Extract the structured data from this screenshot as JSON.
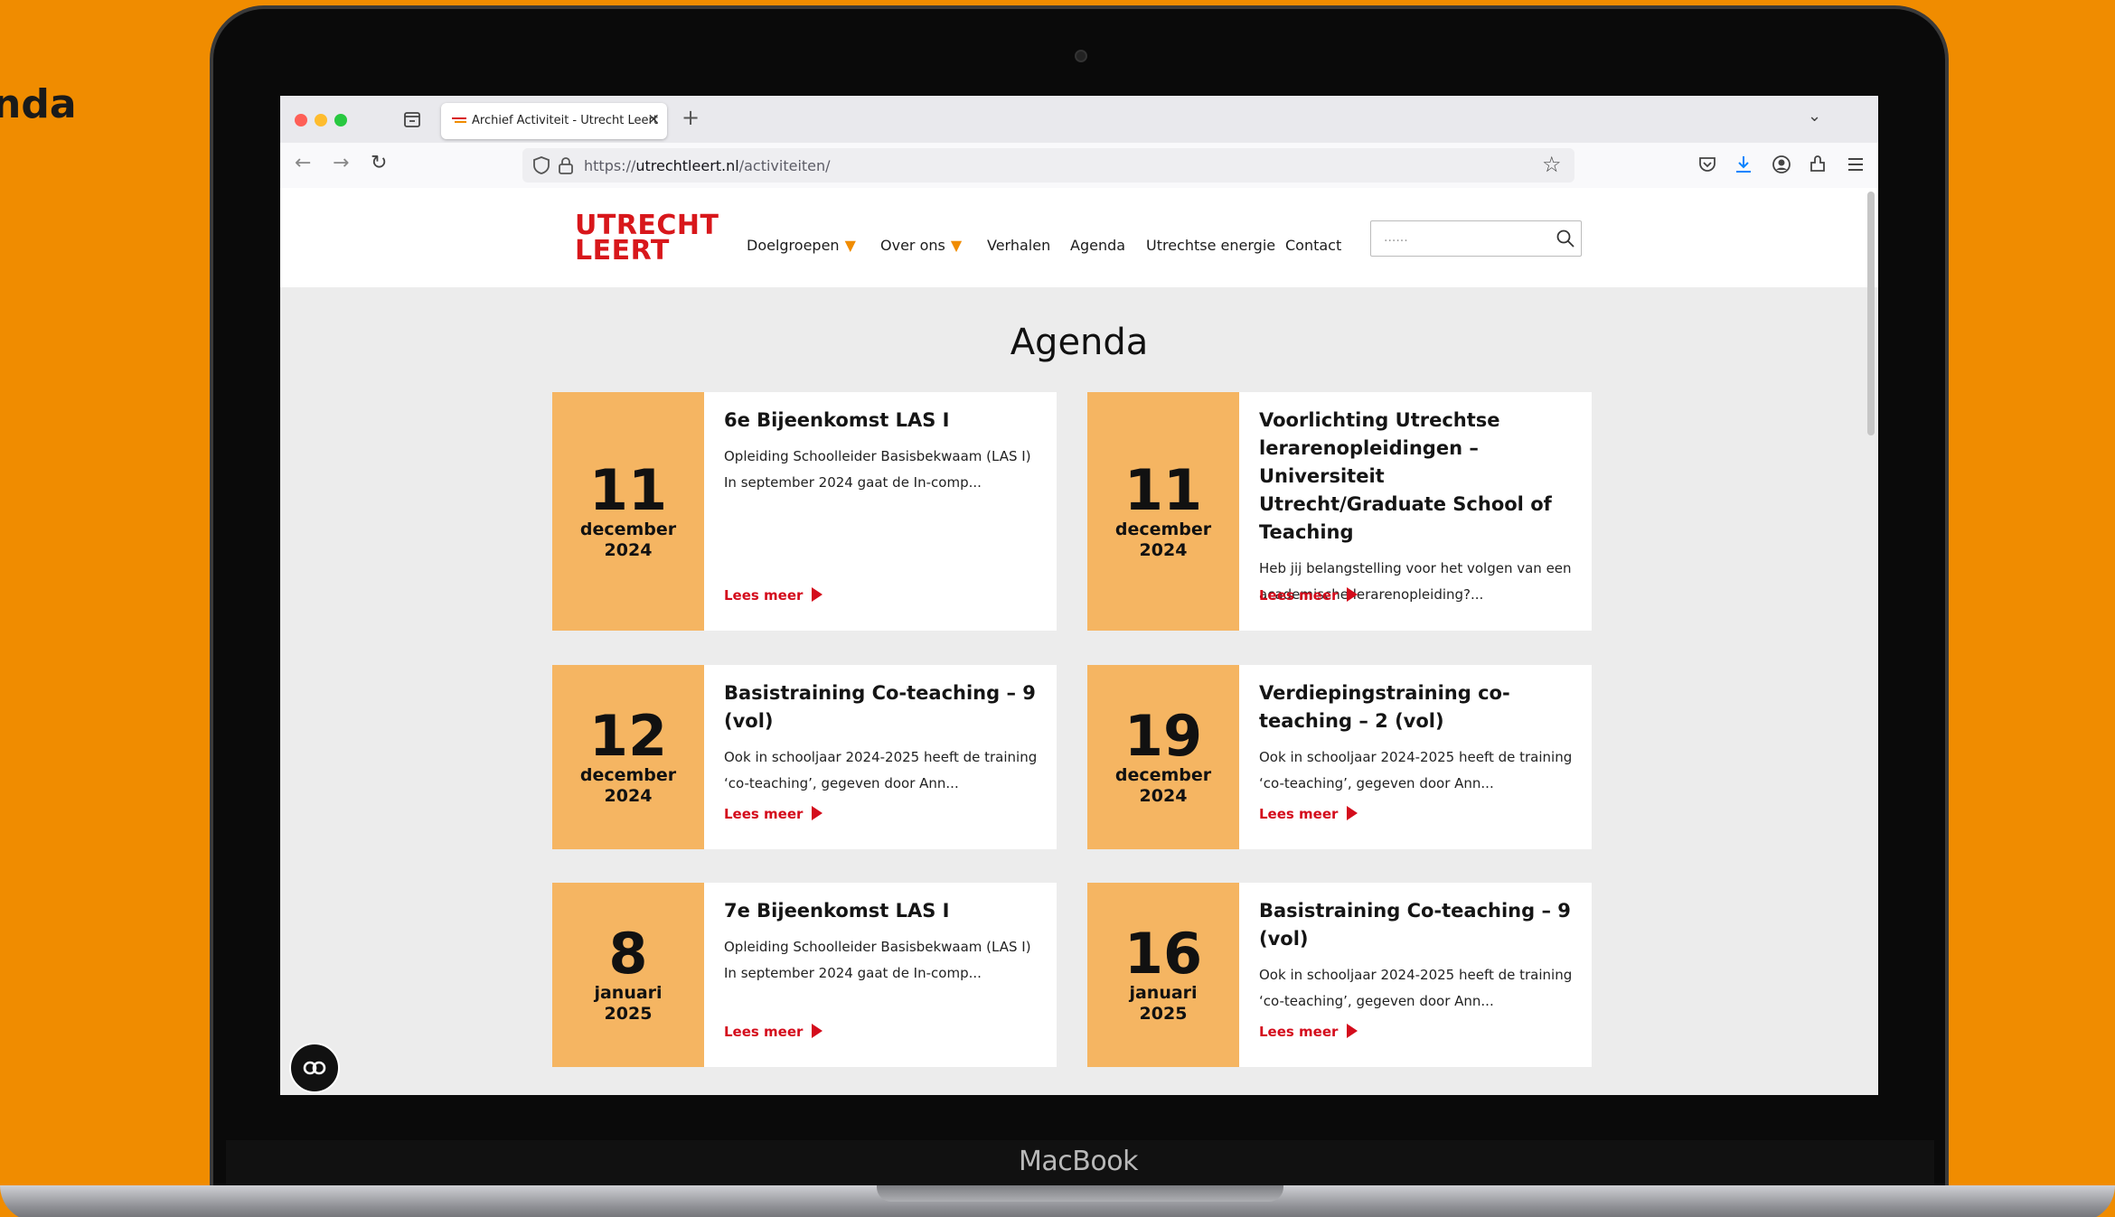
{
  "side_title": "nda",
  "device_label": "MacBook",
  "browser": {
    "tab_title": "Archief Activiteit - Utrecht Leert",
    "tab_close": "×",
    "new_tab": "+",
    "tab_list": "⌄",
    "back": "←",
    "forward": "→",
    "reload": "↻",
    "url_prefix": "https://",
    "url_domain": "utrechtleert.nl",
    "url_path": "/activiteiten/",
    "bookmark": "☆",
    "colors": {
      "close": "#fe5f57",
      "minimize": "#febc2e",
      "maximize": "#28c840"
    }
  },
  "site": {
    "logo_line1": "UTRECHT",
    "logo_line2": "LEERT",
    "nav": {
      "doelgroepen": "Doelgroepen",
      "over_ons": "Over ons",
      "verhalen": "Verhalen",
      "agenda": "Agenda",
      "utrechtse_energie": "Utrechtse energie",
      "contact": "Contact",
      "caret": "▼"
    },
    "search_placeholder": "......",
    "page_title": "Agenda",
    "read_more": "Lees meer",
    "colors": {
      "brand_red": "#d8171b",
      "accent_orange": "#f08c00",
      "date_block": "#f5b562"
    }
  },
  "events": [
    {
      "day": "11",
      "month": "december",
      "year": "2024",
      "title": "6e Bijeenkomst LAS I",
      "excerpt": "Opleiding Schoolleider Basisbekwaam (LAS I) In september 2024 gaat de In-comp..."
    },
    {
      "day": "11",
      "month": "december",
      "year": "2024",
      "title": "Voorlichting Utrechtse lerarenopleidingen – Universiteit Utrecht/Graduate School of Teaching",
      "excerpt": "Heb jij  belangstelling voor het volgen van een academische lerarenopleiding?..."
    },
    {
      "day": "12",
      "month": "december",
      "year": "2024",
      "title": "Basistraining Co-teaching – 9 (vol)",
      "excerpt": "Ook in schooljaar 2024-2025 heeft de training ‘co-teaching’, gegeven door Ann..."
    },
    {
      "day": "19",
      "month": "december",
      "year": "2024",
      "title": "Verdiepingstraining co-teaching – 2 (vol)",
      "excerpt": "Ook in schooljaar 2024-2025 heeft de training ‘co-teaching’, gegeven door Ann..."
    },
    {
      "day": "8",
      "month": "januari",
      "year": "2025",
      "title": "7e Bijeenkomst LAS I",
      "excerpt": "Opleiding Schoolleider Basisbekwaam (LAS I) In september 2024 gaat de In-comp..."
    },
    {
      "day": "16",
      "month": "januari",
      "year": "2025",
      "title": "Basistraining Co-teaching – 9 (vol)",
      "excerpt": "Ook in schooljaar 2024-2025 heeft de training ‘co-teaching’, gegeven door Ann..."
    }
  ]
}
